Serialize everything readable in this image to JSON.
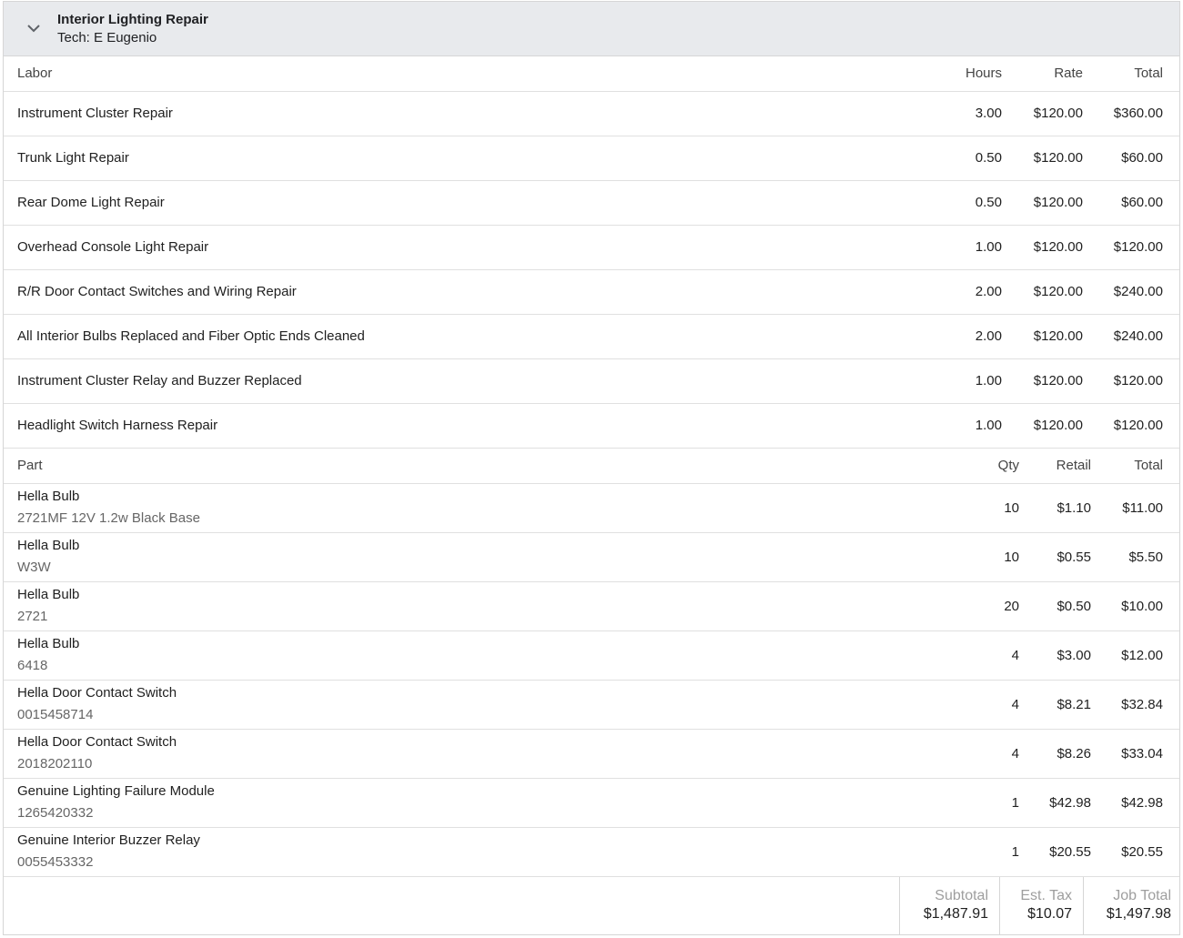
{
  "job": {
    "title": "Interior Lighting Repair",
    "tech": "Tech: E Eugenio"
  },
  "labor": {
    "headers": {
      "name": "Labor",
      "hours": "Hours",
      "rate": "Rate",
      "total": "Total"
    },
    "rows": [
      {
        "name": "Instrument Cluster Repair",
        "hours": "3.00",
        "rate": "$120.00",
        "total": "$360.00"
      },
      {
        "name": "Trunk Light Repair",
        "hours": "0.50",
        "rate": "$120.00",
        "total": "$60.00"
      },
      {
        "name": "Rear Dome Light Repair",
        "hours": "0.50",
        "rate": "$120.00",
        "total": "$60.00"
      },
      {
        "name": "Overhead Console Light Repair",
        "hours": "1.00",
        "rate": "$120.00",
        "total": "$120.00"
      },
      {
        "name": "R/R Door Contact Switches and Wiring Repair",
        "hours": "2.00",
        "rate": "$120.00",
        "total": "$240.00"
      },
      {
        "name": "All Interior Bulbs Replaced and Fiber Optic Ends Cleaned",
        "hours": "2.00",
        "rate": "$120.00",
        "total": "$240.00"
      },
      {
        "name": "Instrument Cluster Relay and Buzzer Replaced",
        "hours": "1.00",
        "rate": "$120.00",
        "total": "$120.00"
      },
      {
        "name": "Headlight Switch Harness Repair",
        "hours": "1.00",
        "rate": "$120.00",
        "total": "$120.00"
      }
    ]
  },
  "parts": {
    "headers": {
      "name": "Part",
      "qty": "Qty",
      "retail": "Retail",
      "total": "Total"
    },
    "rows": [
      {
        "name": "Hella Bulb",
        "number": "2721MF 12V 1.2w Black Base",
        "qty": "10",
        "retail": "$1.10",
        "total": "$11.00"
      },
      {
        "name": "Hella Bulb",
        "number": "W3W",
        "qty": "10",
        "retail": "$0.55",
        "total": "$5.50"
      },
      {
        "name": "Hella Bulb",
        "number": "2721",
        "qty": "20",
        "retail": "$0.50",
        "total": "$10.00"
      },
      {
        "name": "Hella Bulb",
        "number": "6418",
        "qty": "4",
        "retail": "$3.00",
        "total": "$12.00"
      },
      {
        "name": "Hella Door Contact Switch",
        "number": "0015458714",
        "qty": "4",
        "retail": "$8.21",
        "total": "$32.84"
      },
      {
        "name": "Hella Door Contact Switch",
        "number": "2018202110",
        "qty": "4",
        "retail": "$8.26",
        "total": "$33.04"
      },
      {
        "name": "Genuine Lighting Failure Module",
        "number": "1265420332",
        "qty": "1",
        "retail": "$42.98",
        "total": "$42.98"
      },
      {
        "name": "Genuine Interior Buzzer Relay",
        "number": "0055453332",
        "qty": "1",
        "retail": "$20.55",
        "total": "$20.55"
      }
    ]
  },
  "totals": {
    "subtotal_label": "Subtotal",
    "subtotal": "$1,487.91",
    "tax_label": "Est. Tax",
    "tax": "$10.07",
    "job_total_label": "Job Total",
    "job_total": "$1,497.98"
  },
  "icons": {
    "collapse": "chevron-down-icon"
  }
}
